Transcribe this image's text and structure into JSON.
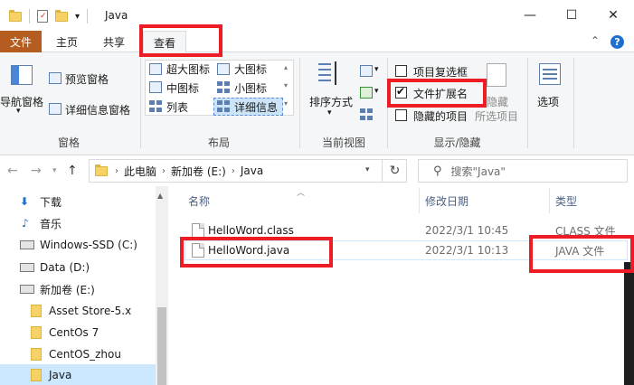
{
  "window": {
    "title": "Java",
    "controls": {
      "minimize": "—",
      "maximize": "☐",
      "close": "✕"
    }
  },
  "ribbon_tabs": [
    {
      "label": "文件"
    },
    {
      "label": "主页"
    },
    {
      "label": "共享"
    },
    {
      "label": "查看"
    }
  ],
  "ribbon": {
    "pane": {
      "nav_pane": "导航窗格",
      "preview_pane": "预览窗格",
      "details_pane": "详细信息窗格",
      "group_label": "窗格"
    },
    "layout": {
      "items": [
        "超大图标",
        "大图标",
        "中图标",
        "小图标",
        "列表",
        "详细信息"
      ],
      "group_label": "布局"
    },
    "current_view": {
      "sort_by": "排序方式",
      "group_label": "当前视图"
    },
    "show_hide": {
      "item_checkboxes": "项目复选框",
      "file_extensions": "文件扩展名",
      "hidden_items": "隐藏的项目",
      "hide": "隐藏",
      "hide_selected": "所选项目",
      "group_label": "显示/隐藏"
    },
    "options": "选项"
  },
  "address": {
    "breadcrumb": [
      "此电脑",
      "新加卷 (E:)",
      "Java"
    ],
    "search_placeholder": "搜索\"Java\""
  },
  "sidebar": {
    "items": [
      {
        "label": "下载",
        "icon": "download-arrow-icon"
      },
      {
        "label": "音乐",
        "icon": "music-note-icon"
      },
      {
        "label": "Windows-SSD (C:)",
        "icon": "drive-icon"
      },
      {
        "label": "Data (D:)",
        "icon": "drive-icon"
      },
      {
        "label": "新加卷 (E:)",
        "icon": "drive-icon"
      },
      {
        "label": "Asset Store-5.x",
        "icon": "folder-icon"
      },
      {
        "label": "CentOs 7",
        "icon": "folder-icon"
      },
      {
        "label": "CentOS_zhou",
        "icon": "folder-icon"
      },
      {
        "label": "Java",
        "icon": "folder-icon",
        "selected": true
      }
    ]
  },
  "file_list": {
    "columns": [
      "名称",
      "修改日期",
      "类型"
    ],
    "rows": [
      {
        "name": "HelloWord.class",
        "modified": "2022/3/1 10:45",
        "type": "CLASS 文件"
      },
      {
        "name": "HelloWord.java",
        "modified": "2022/3/1 10:13",
        "type": "JAVA 文件"
      }
    ]
  },
  "colors": {
    "file_tab": "#b55c20",
    "selection": "#cce8ff",
    "highlight_box": "#ee1c25",
    "accent": "#1f6fd0"
  }
}
